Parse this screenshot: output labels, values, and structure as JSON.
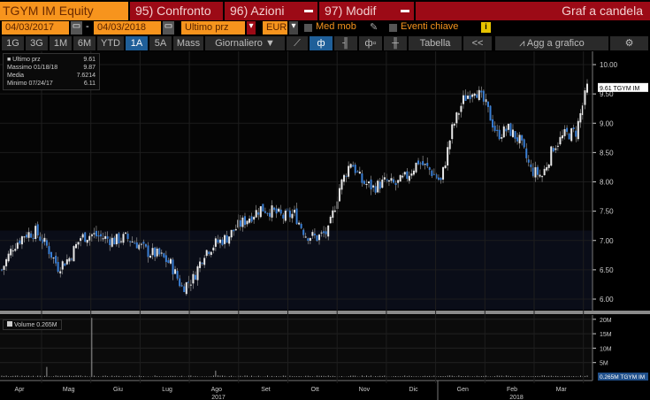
{
  "header": {
    "ticker": "TGYM IM Equity",
    "compare": "95) Confronto",
    "actions": "96) Azioni",
    "edit": "97) Modif",
    "title": "Graf a candela"
  },
  "controls": {
    "start_date": "04/03/2017",
    "dash": "-",
    "end_date": "04/03/2018",
    "field": "Ultimo prz",
    "currency": "EUR",
    "moving_avg": "Med mob",
    "key_events": "Eventi chiave",
    "info": "i"
  },
  "toolbar": {
    "ranges": [
      "1G",
      "3G",
      "1M",
      "6M",
      "YTD",
      "1A",
      "5A",
      "Mass"
    ],
    "active_range": "1A",
    "frequency": "Giornaliero ▼",
    "table": "Tabella",
    "collapse": "<<",
    "add": "Agg a grafico"
  },
  "legend": {
    "rows": [
      {
        "label": "Ultimo prz",
        "value": "9.61"
      },
      {
        "label": "Massimo 01/18/18",
        "value": "9.87"
      },
      {
        "label": "Media",
        "value": "7.6214"
      },
      {
        "label": "Minimo 07/24/17",
        "value": "6.11"
      }
    ]
  },
  "price_tag": "9.61 TGYM IM",
  "volume_legend": "Volume 0.265M",
  "volume_tag": "0.265M TGYM IM",
  "colors": {
    "up": "#e8e8e8",
    "down": "#3a7fd5",
    "accent": "#f7941d",
    "red": "#9c0a16"
  },
  "chart_data": {
    "type": "candlestick",
    "title": "Graf a candela",
    "y_ticks": [
      "10.00",
      "9.50",
      "9.00",
      "8.50",
      "8.00",
      "7.50",
      "7.00",
      "6.50",
      "6.00"
    ],
    "ylim": [
      5.9,
      10.15
    ],
    "weekly_close": [
      6.5,
      6.9,
      7.1,
      7.15,
      6.9,
      6.55,
      6.7,
      7.05,
      7.1,
      7.05,
      7.0,
      7.05,
      6.95,
      6.8,
      6.75,
      6.6,
      6.2,
      6.35,
      6.8,
      6.95,
      7.05,
      7.25,
      7.4,
      7.55,
      7.5,
      7.4,
      7.45,
      7.1,
      7.05,
      7.15,
      7.9,
      8.35,
      8.0,
      7.9,
      8.0,
      7.95,
      8.1,
      8.35,
      8.2,
      8.0,
      8.9,
      9.4,
      9.6,
      9.3,
      8.8,
      8.9,
      8.7,
      8.2,
      8.1,
      8.6,
      8.8,
      8.85,
      9.61
    ],
    "volume_ticks": [
      "20M",
      "15M",
      "10M",
      "5M"
    ],
    "volume_max": 21,
    "volume_baseline": 0.265,
    "volume_spikes": [
      {
        "week": 4,
        "value": 3.5
      },
      {
        "week": 8,
        "value": 20.5
      },
      {
        "week": 19,
        "value": 2.2
      }
    ],
    "months": [
      "Apr",
      "Mag",
      "Giu",
      "Lug",
      "Ago",
      "Set",
      "Ott",
      "Nov",
      "Dic",
      "Gen",
      "Feb",
      "Mar"
    ],
    "years": [
      "2017",
      "2018"
    ]
  }
}
